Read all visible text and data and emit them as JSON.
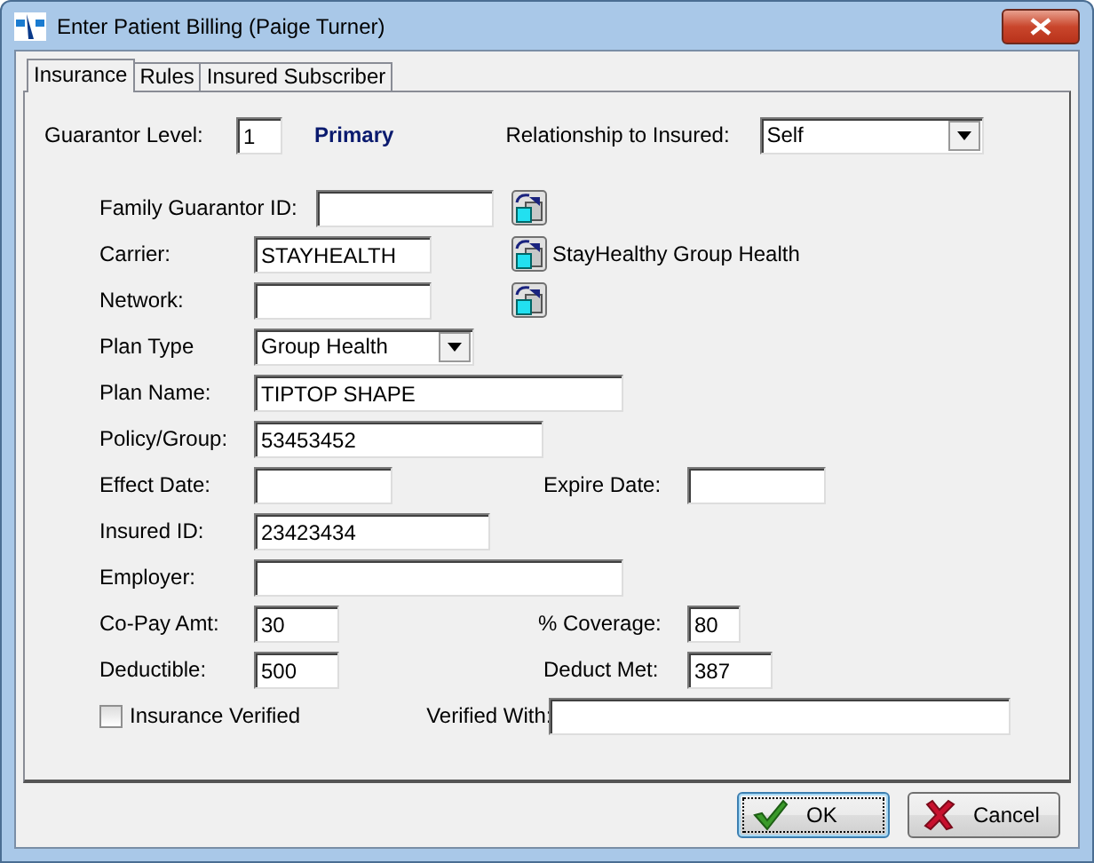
{
  "window": {
    "title": "Enter Patient Billing (Paige Turner)"
  },
  "tabs": [
    {
      "label": "Insurance",
      "selected": true
    },
    {
      "label": "Rules",
      "selected": false
    },
    {
      "label": "Insured Subscriber",
      "selected": false
    }
  ],
  "rows": [
    {
      "left": {
        "kind": "level",
        "label": "Guarantor Level:",
        "value": "1",
        "level_name": "Primary"
      },
      "right": {
        "kind": "dropdown",
        "label": "Relationship to Insured:",
        "value": "Self"
      }
    },
    {
      "left": {
        "kind": "lookup",
        "label": "Family Guarantor ID:"
      }
    },
    {
      "left": {
        "kind": "lookup",
        "label": "Carrier:",
        "value": "STAYHEALTH",
        "description": "StayHealthy Group Health"
      }
    },
    {
      "left": {
        "kind": "lookup",
        "label": "Network:"
      }
    },
    {
      "left": {
        "kind": "dropdown",
        "label": "Plan Type",
        "value": "Group Health"
      }
    },
    {
      "left": {
        "kind": "text",
        "label": "Plan Name:",
        "value": "TIPTOP SHAPE"
      }
    },
    {
      "left": {
        "kind": "text",
        "label": "Policy/Group:",
        "value": "53453452"
      }
    },
    {
      "left": {
        "kind": "text",
        "label": "Effect Date:"
      },
      "right": {
        "kind": "text",
        "label": "Expire Date:"
      }
    },
    {
      "left": {
        "kind": "text",
        "label": "Insured ID:",
        "value": "23423434"
      }
    },
    {
      "left": {
        "kind": "text",
        "label": "Employer:"
      }
    },
    {
      "left": {
        "kind": "text",
        "label": "Co-Pay Amt:",
        "value": "30"
      },
      "right": {
        "kind": "text",
        "label": "% Coverage:",
        "value": "80"
      }
    },
    {
      "left": {
        "kind": "text",
        "label": "Deductible:",
        "value": "500"
      },
      "right": {
        "kind": "text",
        "label": "Deduct Met:",
        "value": "387"
      }
    },
    {
      "left": {
        "kind": "checkbox",
        "label": "Insurance Verified",
        "checked": false
      },
      "right": {
        "kind": "text",
        "label": "Verified With:"
      }
    }
  ],
  "buttons": [
    {
      "kind": "ok",
      "label": "OK",
      "focused": true
    },
    {
      "kind": "cancel",
      "label": "Cancel",
      "focused": false
    }
  ]
}
